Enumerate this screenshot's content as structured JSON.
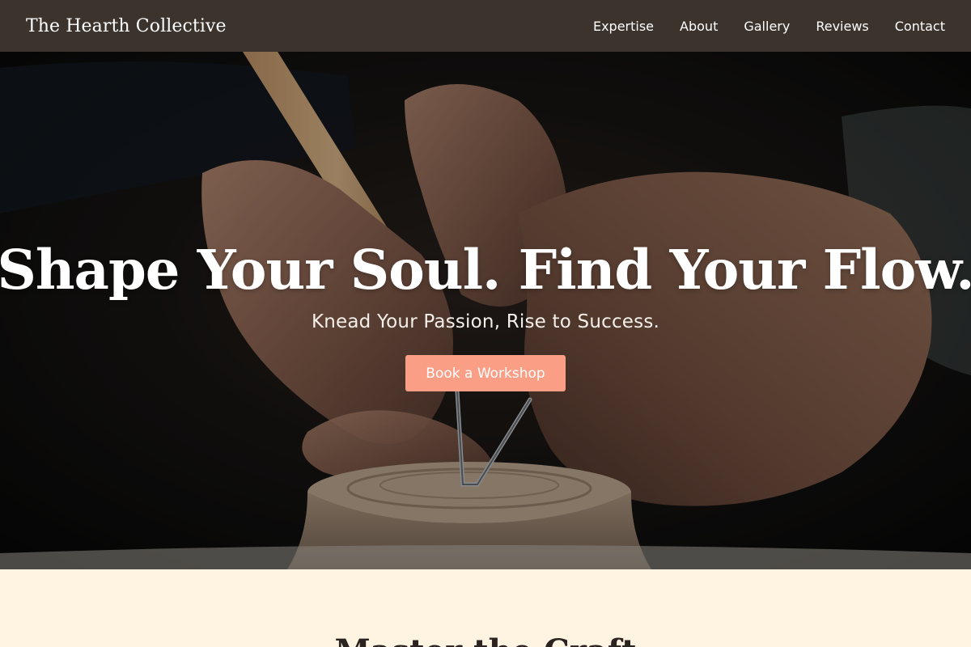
{
  "brand": {
    "name": "The Hearth Collective"
  },
  "nav": {
    "items": [
      {
        "label": "Expertise"
      },
      {
        "label": "About"
      },
      {
        "label": "Gallery"
      },
      {
        "label": "Reviews"
      },
      {
        "label": "Contact"
      }
    ]
  },
  "hero": {
    "title": "Shape Your Soul. Find Your Flow.",
    "subtitle": "Knead Your Passion, Rise to Success.",
    "cta_label": "Book a Workshop",
    "image": "hands-shaping-clay-pottery-photo"
  },
  "crafts_section": {
    "heading": "Master the Craft"
  },
  "colors": {
    "navbar": "#3c332d",
    "cta": "#fa9e86",
    "section_background": "#fff3e2",
    "text_light": "#ffffff"
  }
}
